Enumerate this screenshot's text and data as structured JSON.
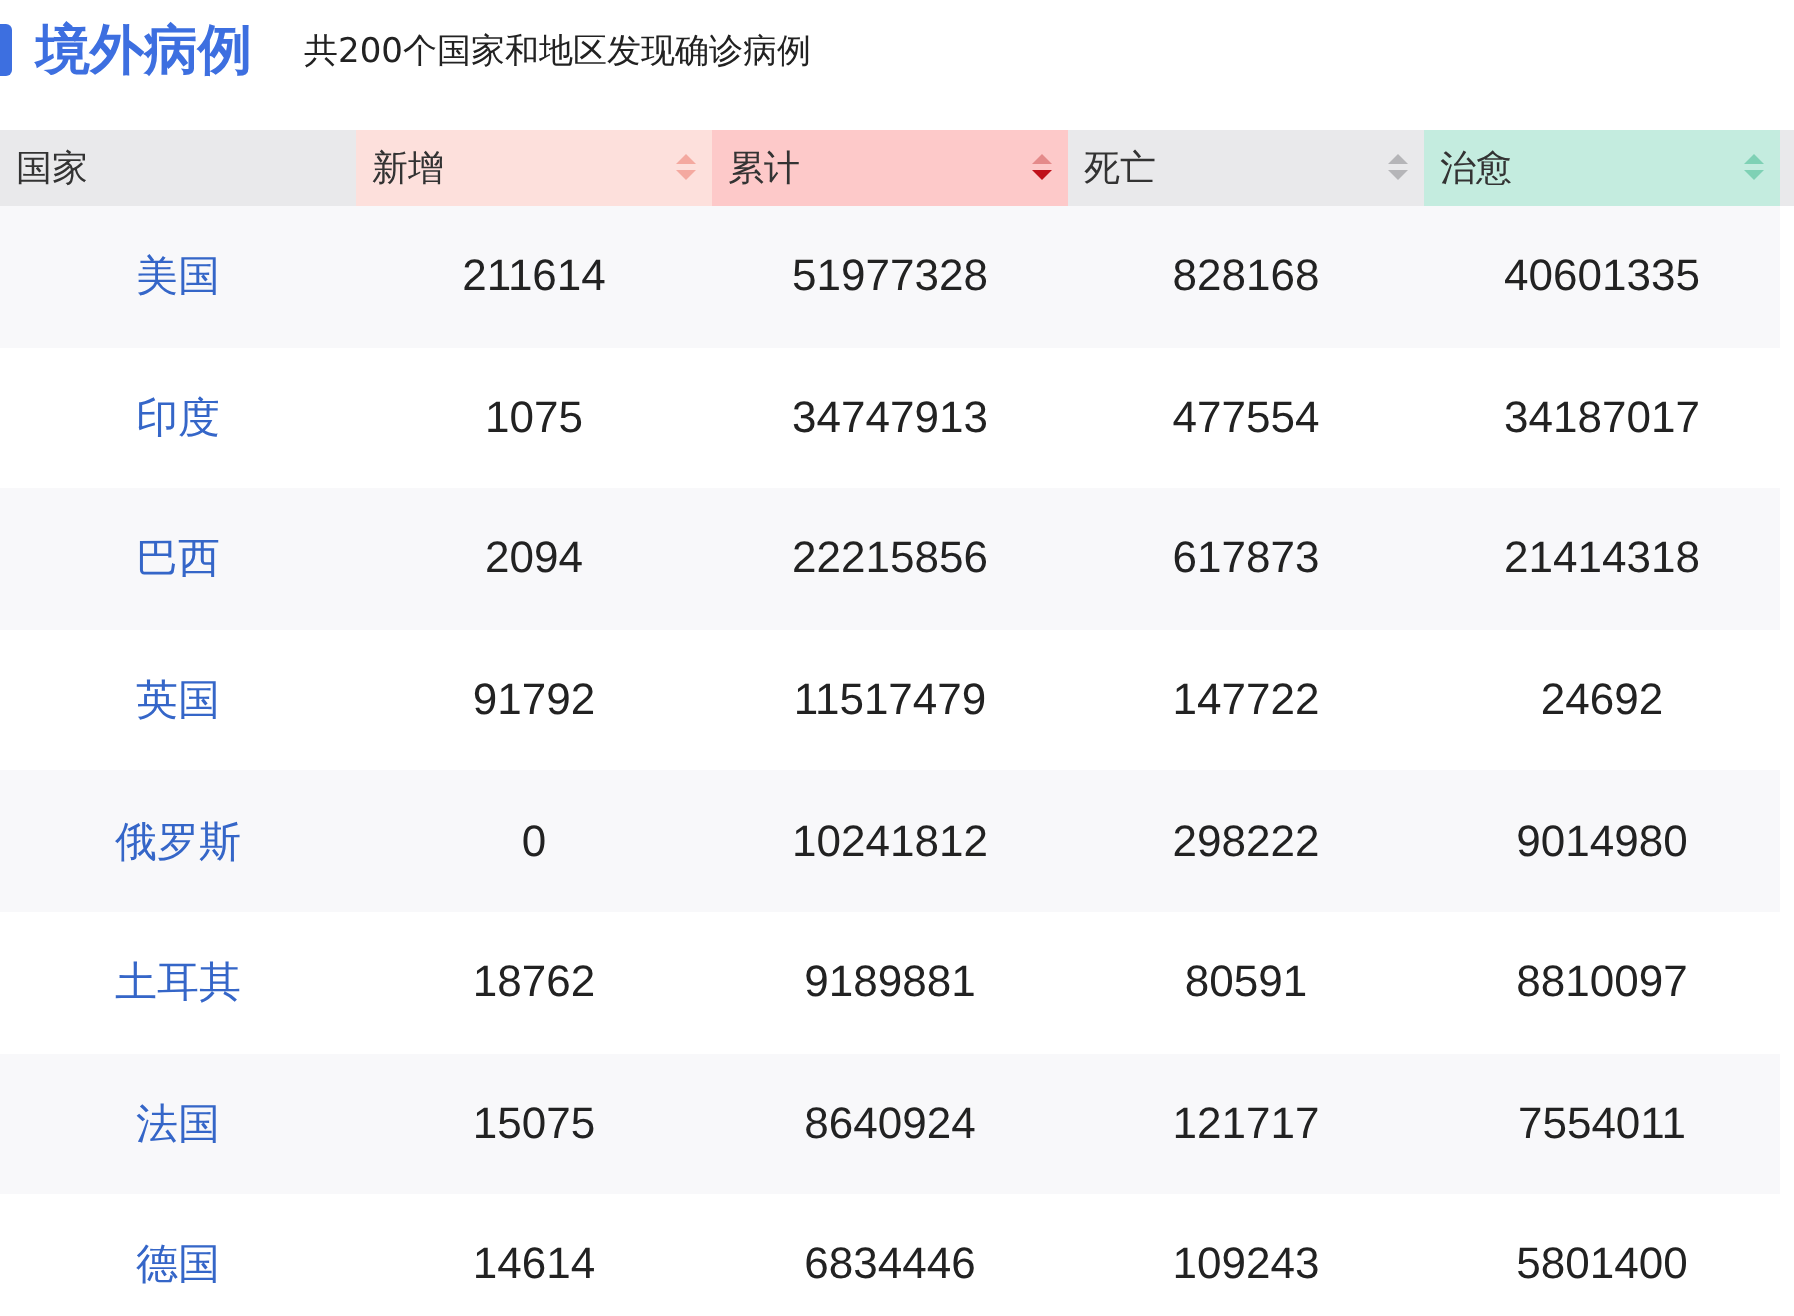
{
  "header": {
    "title": "境外病例",
    "subtitle": "共200个国家和地区发现确诊病例"
  },
  "table": {
    "columns": [
      {
        "label": "国家",
        "color": "#e9e9eb",
        "sortable": false
      },
      {
        "label": "新增",
        "color": "#fde0dc",
        "sortable": true,
        "sorted_descending": false
      },
      {
        "label": "累计",
        "color": "#fdc9c9",
        "sortable": true,
        "sorted_descending": true
      },
      {
        "label": "死亡",
        "color": "#e9e9eb",
        "sortable": true,
        "sorted_descending": false
      },
      {
        "label": "治愈",
        "color": "#c4ecdf",
        "sortable": true,
        "sorted_descending": false
      }
    ],
    "rows": [
      [
        "美国",
        "211614",
        "51977328",
        "828168",
        "40601335"
      ],
      [
        "印度",
        "1075",
        "34747913",
        "477554",
        "34187017"
      ],
      [
        "巴西",
        "2094",
        "22215856",
        "617873",
        "21414318"
      ],
      [
        "英国",
        "91792",
        "11517479",
        "147722",
        "24692"
      ],
      [
        "俄罗斯",
        "0",
        "10241812",
        "298222",
        "9014980"
      ],
      [
        "土耳其",
        "18762",
        "9189881",
        "80591",
        "8810097"
      ],
      [
        "法国",
        "15075",
        "8640924",
        "121717",
        "7554011"
      ],
      [
        "德国",
        "14614",
        "6834446",
        "109243",
        "5801400"
      ]
    ]
  }
}
